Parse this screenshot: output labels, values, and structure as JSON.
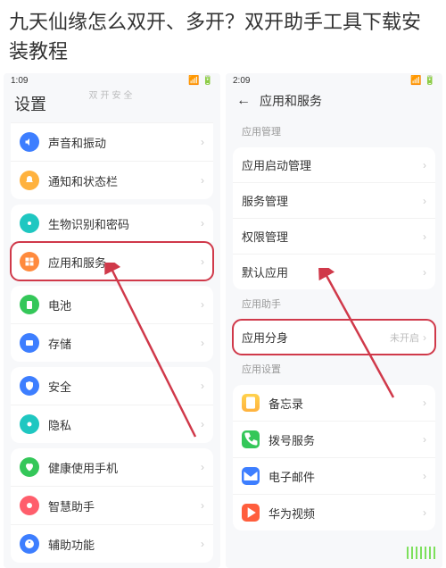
{
  "title": "九天仙缘怎么双开、多开？双开助手工具下载安装教程",
  "left": {
    "time": "1:09",
    "header": "设置",
    "overlay": "双开安全",
    "items": {
      "sound": "声音和振动",
      "notif": "通知和状态栏",
      "bio": "生物识别和密码",
      "apps": "应用和服务",
      "battery": "电池",
      "storage": "存储",
      "security": "安全",
      "privacy": "隐私",
      "health": "健康使用手机",
      "smart": "智慧助手",
      "assist": "辅助功能"
    }
  },
  "right": {
    "time": "2:09",
    "header": "应用和服务",
    "sections": {
      "mgmt": "应用管理",
      "helper": "应用助手",
      "settings": "应用设置"
    },
    "items": {
      "launch": "应用启动管理",
      "service": "服务管理",
      "perm": "权限管理",
      "default": "默认应用",
      "clone": "应用分身",
      "clone_status": "未开启",
      "memo": "备忘录",
      "dial": "拨号服务",
      "email": "电子邮件",
      "video": "华为视频"
    }
  }
}
